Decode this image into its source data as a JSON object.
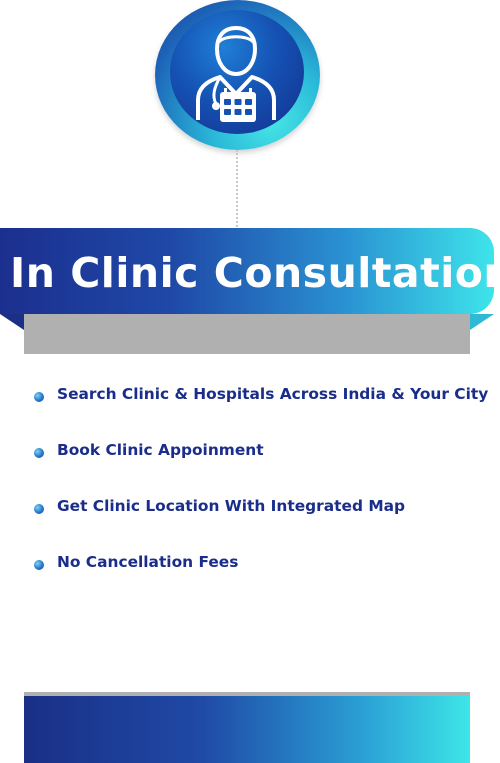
{
  "badge": {
    "icon": "doctor-calendar-icon",
    "colors": {
      "ring_outer": "#2ab9d8",
      "ring_inner": "#1552b3"
    }
  },
  "title": {
    "text": "In Clinic Consultation",
    "color": "#ffffff"
  },
  "features": [
    {
      "label": "Search Clinic & Hospitals Across India & Your City"
    },
    {
      "label": "Book Clinic Appoinment"
    },
    {
      "label": "Get Clinic Location With Integrated Map"
    },
    {
      "label": "No Cancellation Fees"
    }
  ],
  "colors": {
    "brand_dark": "#1a2d8a",
    "brand_light": "#3ee4ea",
    "gray": "#b0b0b0"
  }
}
